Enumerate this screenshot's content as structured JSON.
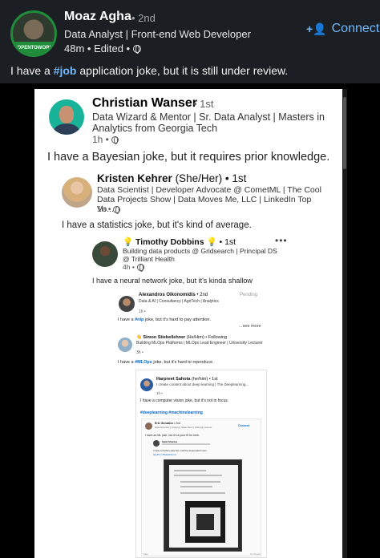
{
  "outer_post": {
    "author_name": "Moaz Agha",
    "degree": "• 2nd",
    "headline": "Data Analyst | Front-end Web Developer",
    "time": "48m • Edited •",
    "avatar_badge": "#OPENTOWORK",
    "connect_label": "Connect",
    "text_before": "I have a ",
    "hashtag": "#job",
    "text_after": " application joke, but it is still under review."
  },
  "level1": {
    "author_name": "Christian Wanser",
    "degree": "• 1st",
    "headline": "Data Wizard & Mentor | Sr. Data Analyst | Masters in Analytics from Georgia Tech",
    "time": "1h •",
    "text": "I have a Bayesian joke, but it requires prior knowledge."
  },
  "level2": {
    "author_name": "Kristen Kehrer",
    "pronouns": "(She/Her)",
    "degree": "• 1st",
    "headline": "Data Scientist | Developer Advocate @ CometML | The Cool Data Projects Show | Data Moves Me, LLC | LinkedIn Top Vo...",
    "time": "1h •",
    "text": "I have a statistics joke, but it's kind of average."
  },
  "level3": {
    "author_name": "Timothy Dobbins",
    "degree": "• 1st",
    "headline": "Building data products @ Gridsearch | Principal DS @ Trilliant Health",
    "time": "4h •",
    "text": "I have a neural network joke, but it's kinda shallow",
    "menu": "•••"
  },
  "level4": {
    "author_name": "Alexandros Oikonomidis",
    "degree": "• 2nd",
    "pending": "Pending",
    "headline": "Data & AI | Consultancy | AgriTech | Analytics",
    "time": "1h •",
    "text_before": "I have a ",
    "hashtag": "#nlp",
    "text_after": " joke, but it's hard to pay attention.",
    "see_more": "...see more"
  },
  "level5": {
    "author_name": "Simon Stiebellehner",
    "pronouns": "(He/Him) • Following",
    "headline": "Building MLOps Platforms | MLOps Lead Engineer | University Lecturer",
    "time": "3h •",
    "text_before": "I have a ",
    "hashtag": "#MLOps",
    "text_after": " joke, but it's hard to reproduce."
  },
  "level6": {
    "author_name": "Harpreet Sahota",
    "pronouns": "(he/him) • 1st",
    "headline": "I create content about deep learning | The Deeplearning...",
    "time": "1h •",
    "text": "I have a computer vision joke, but it's not in focus.",
    "hashtags": "#deeplearning #machinelearning"
  },
  "level7": {
    "author_name": "Eric Gonzalez",
    "degree": "• 2nd",
    "connect_label": "Connect",
    "headline": "Data Scientist | Analyst | Stats Nerd | Lifelong Learner",
    "text": "I have an ML joke, but it's a poor fit for here."
  },
  "level8": {
    "author_name": "Sahil Sharma",
    "text": "I have a Python joke but it will be deprecated soon.",
    "hashtags": "#python #datascience"
  },
  "footer": {
    "left": "Like",
    "right": "Comment"
  }
}
